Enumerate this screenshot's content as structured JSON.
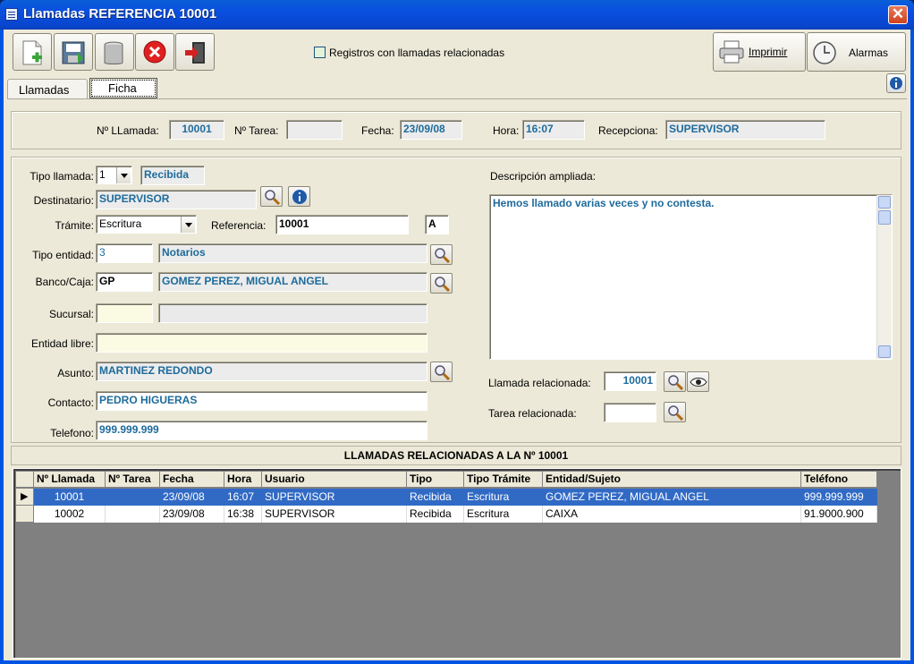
{
  "window": {
    "title": "Llamadas REFERENCIA 10001",
    "close_glyph": "✕"
  },
  "toolbar": {
    "related_checkbox_label": "Registros con llamadas relacionadas",
    "print_label": "Imprimir",
    "alarms_label": "Alarmas"
  },
  "tabs": [
    {
      "label": "Llamadas"
    },
    {
      "label": "Ficha",
      "active": true
    }
  ],
  "header": {
    "num_llamada_label": "Nº LLamada:",
    "num_llamada": "10001",
    "num_tarea_label": "Nº Tarea:",
    "num_tarea": "",
    "fecha_label": "Fecha:",
    "fecha": "23/09/08",
    "hora_label": "Hora:",
    "hora": "16:07",
    "recepciona_label": "Recepciona:",
    "recepciona": "SUPERVISOR"
  },
  "form": {
    "tipo_llamada_label": "Tipo llamada:",
    "tipo_llamada": "1",
    "tipo_llamada_desc": "Recibida",
    "destinatario_label": "Destinatario:",
    "destinatario": "SUPERVISOR",
    "tramite_label": "Trámite:",
    "tramite": "Escritura",
    "referencia_label": "Referencia:",
    "referencia": "10001",
    "referencia_suffix": "A",
    "tipo_entidad_label": "Tipo entidad:",
    "tipo_entidad": "3",
    "tipo_entidad_desc": "Notarios",
    "banco_label": "Banco/Caja:",
    "banco": "GP",
    "banco_desc": "GOMEZ PEREZ, MIGUAL ANGEL",
    "sucursal_label": "Sucursal:",
    "sucursal": "",
    "sucursal_desc": "",
    "entidad_libre_label": "Entidad libre:",
    "entidad_libre": "",
    "asunto_label": "Asunto:",
    "asunto": "MARTINEZ REDONDO",
    "contacto_label": "Contacto:",
    "contacto": "PEDRO HIGUERAS",
    "telefono_label": "Telefono:",
    "telefono": "999.999.999",
    "descripcion_label": "Descripción ampliada:",
    "descripcion": "Hemos llamado varias veces y no contesta.",
    "llamada_rel_label": "Llamada relacionada:",
    "llamada_rel": "10001",
    "tarea_rel_label": "Tarea relacionada:",
    "tarea_rel": ""
  },
  "related": {
    "title": "LLAMADAS RELACIONADAS A LA Nº 10001",
    "columns": [
      "Nº Llamada",
      "Nº Tarea",
      "Fecha",
      "Hora",
      "Usuario",
      "Tipo",
      "Tipo Trámite",
      "Entidad/Sujeto",
      "Teléfono"
    ],
    "rows": [
      [
        "10001",
        "",
        "23/09/08",
        "16:07",
        "SUPERVISOR",
        "Recibida",
        "Escritura",
        "GOMEZ PEREZ, MIGUAL ANGEL",
        "999.999.999"
      ],
      [
        "10002",
        "",
        "23/09/08",
        "16:38",
        "SUPERVISOR",
        "Recibida",
        "Escritura",
        "CAIXA",
        "91.9000.900"
      ]
    ],
    "selected_marker": "▶"
  },
  "colors": {
    "title_bar": "#0a4ee0",
    "selection": "#316ac5",
    "field_text": "#1e6b9b",
    "window_bg": "#ece9d8"
  }
}
